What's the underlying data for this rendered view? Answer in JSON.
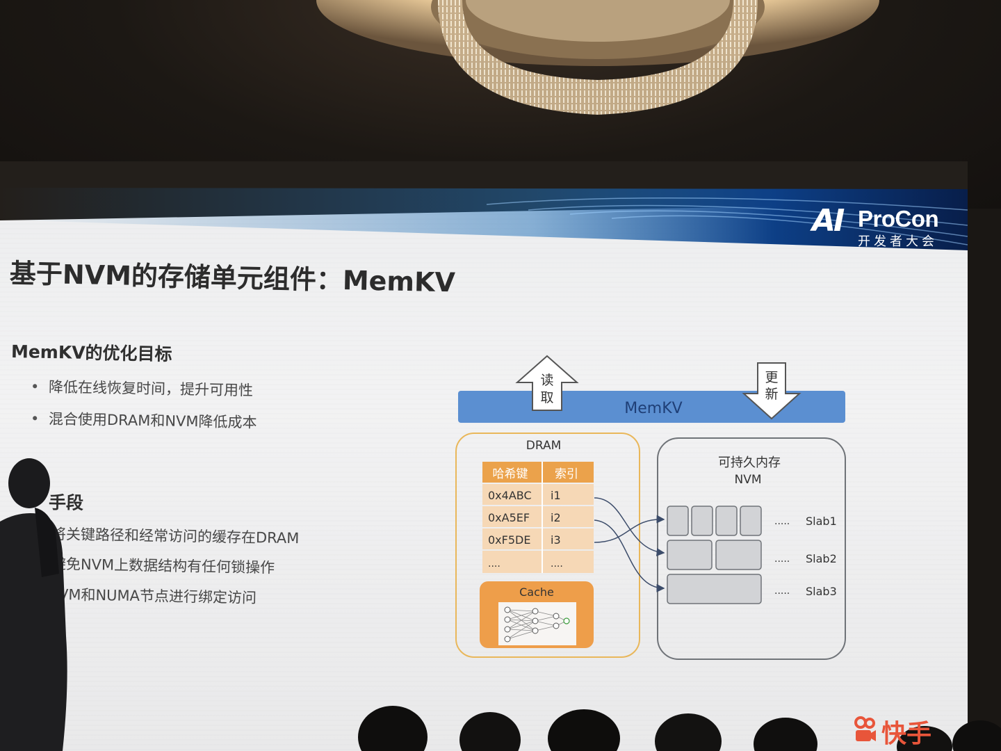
{
  "slide": {
    "title": "基于NVM的存储单元组件：MemKV",
    "logo": {
      "ai": "AI",
      "brand": "ProCon",
      "subtitle": "开发者大会"
    },
    "section1": {
      "heading": "MemKV的优化目标",
      "bullets": [
        "降低在线恢复时间，提升可用性",
        "混合使用DRAM和NVM降低成本"
      ]
    },
    "section2": {
      "heading": "优化手段",
      "visible_heading": "手段",
      "bullets": [
        "将关键路径和经常访问的缓存在DRAM",
        "避免NVM上数据结构有任何锁操作",
        "NVM和NUMA节点进行绑定访问"
      ],
      "visible_bullets": [
        "将关键路径和经常访问的缓存在DRAM",
        "避免NVM上数据结构有任何锁操作",
        "VM和NUMA节点进行绑定访问"
      ]
    }
  },
  "diagram": {
    "bar_label": "MemKV",
    "read_arrow": [
      "读",
      "取"
    ],
    "update_arrow": [
      "更",
      "新"
    ],
    "dram": {
      "label": "DRAM",
      "table_headers": [
        "哈希键",
        "索引"
      ],
      "rows": [
        [
          "0x4ABC",
          "i1"
        ],
        [
          "0xA5EF",
          "i2"
        ],
        [
          "0xF5DE",
          "i3"
        ],
        [
          "....",
          "...."
        ]
      ],
      "cache_label": "Cache"
    },
    "nvm": {
      "label_line1": "可持久内存",
      "label_line2": "NVM",
      "dots": ".....",
      "slabs": [
        "Slab1",
        "Slab2",
        "Slab3"
      ]
    }
  },
  "footer": {
    "sponsor": "快手"
  },
  "colors": {
    "bar_blue": "#5b8fd1",
    "dram_border": "#e9b75a",
    "table_header": "#eba24b",
    "table_row": "#f6d8b6",
    "cache_orange": "#ee9e4a",
    "nvm_border": "#6f7378",
    "slab_fill": "#d2d3d6",
    "kuaishou_red": "#e8553a"
  }
}
